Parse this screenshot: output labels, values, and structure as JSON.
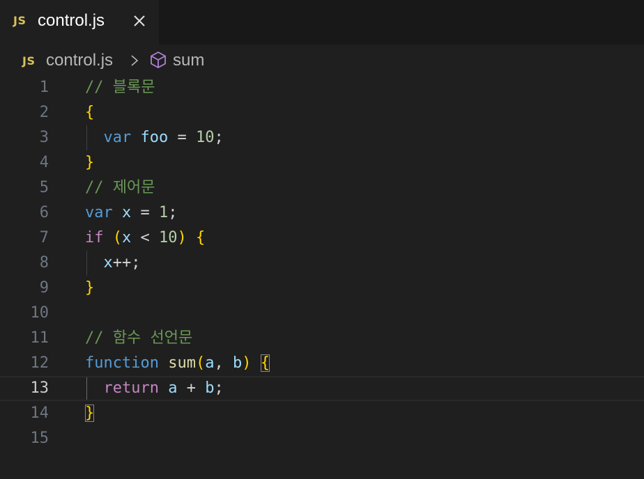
{
  "tab": {
    "icon_text": "JS",
    "label": "control.js"
  },
  "breadcrumb": {
    "icon_text": "JS",
    "file": "control.js",
    "symbol": "sum"
  },
  "editor": {
    "current_line": 13,
    "lines": [
      {
        "num": "1",
        "tokens": [
          {
            "t": "// 블록문",
            "c": "c-comment"
          }
        ]
      },
      {
        "num": "2",
        "tokens": [
          {
            "t": "{",
            "c": "c-br1"
          }
        ]
      },
      {
        "num": "3",
        "tokens": [
          {
            "t": "  ",
            "c": ""
          },
          {
            "t": "var",
            "c": "c-kw"
          },
          {
            "t": " ",
            "c": ""
          },
          {
            "t": "foo",
            "c": "c-var"
          },
          {
            "t": " = ",
            "c": "c-op"
          },
          {
            "t": "10",
            "c": "c-num"
          },
          {
            "t": ";",
            "c": "c-op"
          }
        ]
      },
      {
        "num": "4",
        "tokens": [
          {
            "t": "}",
            "c": "c-br1"
          }
        ]
      },
      {
        "num": "5",
        "tokens": [
          {
            "t": "// 제어문",
            "c": "c-comment"
          }
        ]
      },
      {
        "num": "6",
        "tokens": [
          {
            "t": "var",
            "c": "c-kw"
          },
          {
            "t": " ",
            "c": ""
          },
          {
            "t": "x",
            "c": "c-var"
          },
          {
            "t": " = ",
            "c": "c-op"
          },
          {
            "t": "1",
            "c": "c-num"
          },
          {
            "t": ";",
            "c": "c-op"
          }
        ]
      },
      {
        "num": "7",
        "tokens": [
          {
            "t": "if",
            "c": "c-ctrl"
          },
          {
            "t": " ",
            "c": ""
          },
          {
            "t": "(",
            "c": "c-br1"
          },
          {
            "t": "x",
            "c": "c-var"
          },
          {
            "t": " < ",
            "c": "c-op"
          },
          {
            "t": "10",
            "c": "c-num"
          },
          {
            "t": ")",
            "c": "c-br1"
          },
          {
            "t": " ",
            "c": ""
          },
          {
            "t": "{",
            "c": "c-br1"
          }
        ]
      },
      {
        "num": "8",
        "tokens": [
          {
            "t": "  ",
            "c": ""
          },
          {
            "t": "x",
            "c": "c-var"
          },
          {
            "t": "++;",
            "c": "c-op"
          }
        ]
      },
      {
        "num": "9",
        "tokens": [
          {
            "t": "}",
            "c": "c-br1"
          }
        ]
      },
      {
        "num": "10",
        "tokens": []
      },
      {
        "num": "11",
        "tokens": [
          {
            "t": "// 함수 선언문",
            "c": "c-comment"
          }
        ]
      },
      {
        "num": "12",
        "tokens": [
          {
            "t": "function",
            "c": "c-kw"
          },
          {
            "t": " ",
            "c": ""
          },
          {
            "t": "sum",
            "c": "c-fn"
          },
          {
            "t": "(",
            "c": "c-br1"
          },
          {
            "t": "a",
            "c": "c-var"
          },
          {
            "t": ", ",
            "c": "c-op"
          },
          {
            "t": "b",
            "c": "c-var"
          },
          {
            "t": ")",
            "c": "c-br1"
          },
          {
            "t": " ",
            "c": ""
          },
          {
            "t": "{",
            "c": "c-br1 match"
          }
        ]
      },
      {
        "num": "13",
        "tokens": [
          {
            "t": "  ",
            "c": ""
          },
          {
            "t": "return",
            "c": "c-ctrl"
          },
          {
            "t": " ",
            "c": ""
          },
          {
            "t": "a",
            "c": "c-var"
          },
          {
            "t": " + ",
            "c": "c-op"
          },
          {
            "t": "b",
            "c": "c-var"
          },
          {
            "t": ";",
            "c": "c-op"
          }
        ]
      },
      {
        "num": "14",
        "tokens": [
          {
            "t": "}",
            "c": "c-br1 match"
          }
        ]
      },
      {
        "num": "15",
        "tokens": []
      }
    ]
  },
  "colors": {
    "background": "#1f1f1f",
    "tabbar": "#181818",
    "js_icon": "#d8c15a",
    "comment": "#6a9955",
    "keyword": "#569cd6",
    "control": "#c586c0",
    "variable": "#9cdcfe",
    "number": "#b5cea8",
    "function": "#dcdcaa",
    "bracket": "#ffd700"
  }
}
